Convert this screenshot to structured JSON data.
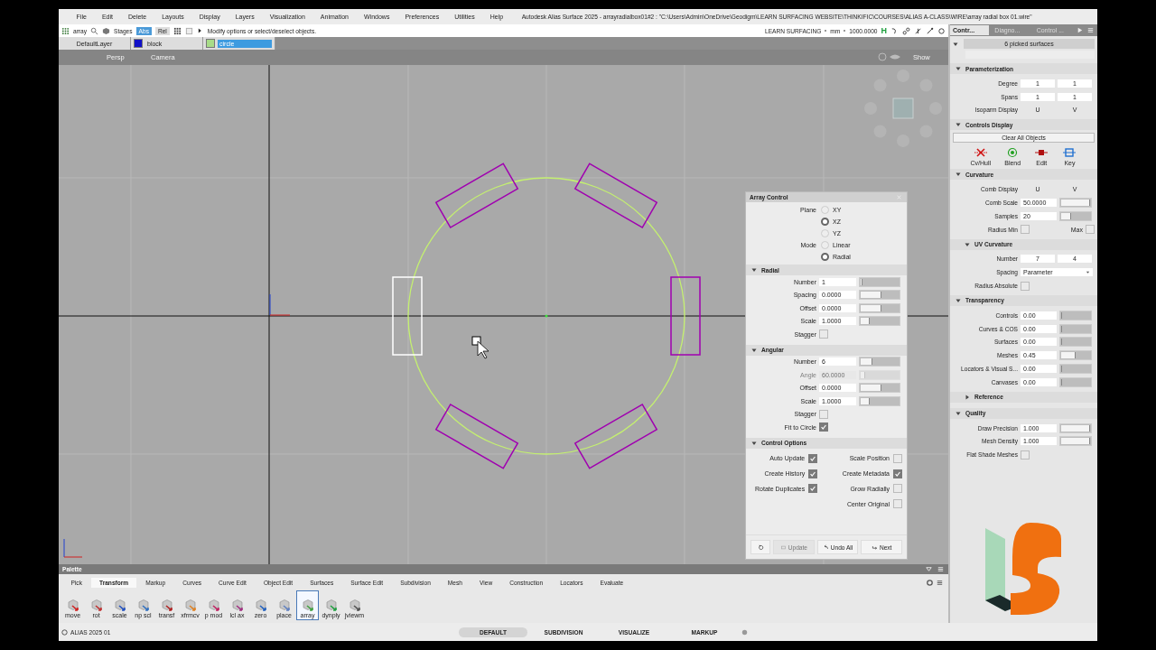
{
  "menu_bar": {
    "items": [
      "File",
      "Edit",
      "Delete",
      "Layouts",
      "Display",
      "Layers",
      "Visualization",
      "Animation",
      "Windows",
      "Preferences",
      "Utilities",
      "Help"
    ],
    "title": "Autodesk Alias Surface 2025   - arrayradialbox01#2 : \"C:\\Users\\Admin\\OneDrive\\Geodigm\\LEARN SURFACING WEBSITE\\THINKIFIC\\COURSES\\ALIAS A-CLASS\\WIRE\\array radial box 01.wire\""
  },
  "toolbar": {
    "tool": "array",
    "stages": "Stages",
    "modes": [
      {
        "label": "Abs",
        "selected": true
      },
      {
        "label": "Rel",
        "selected": false
      }
    ],
    "prompt": "Modify options or select/deselect objects.",
    "project": "LEARN SURFACING",
    "units": "mm",
    "tolerance": "1000.0000",
    "history": "H"
  },
  "layers": [
    {
      "name": "DefaultLayer",
      "selected": false
    },
    {
      "name": "block",
      "color": "#1010c8",
      "selected": false
    },
    {
      "name": "circle",
      "color": "#a8dc88",
      "selected": true
    }
  ],
  "viewport": {
    "view_label": "Persp",
    "camera_label": "Camera",
    "show_label": "Show",
    "boxes": [
      {
        "selected": false
      },
      {
        "selected": false
      },
      {
        "selected": false
      },
      {
        "selected": true
      },
      {
        "selected": false
      },
      {
        "selected": false
      }
    ]
  },
  "array_control": {
    "title": "Array Control",
    "radio_groups": [
      {
        "label": "Plane",
        "options": [
          {
            "label": "XY",
            "selected": false
          },
          {
            "label": "XZ",
            "selected": true
          },
          {
            "label": "YZ",
            "selected": false
          }
        ]
      },
      {
        "label": "Mode",
        "options": [
          {
            "label": "Linear",
            "selected": false
          },
          {
            "label": "Radial",
            "selected": true
          }
        ]
      }
    ],
    "sections": [
      {
        "title": "Radial",
        "expanded": true,
        "rows": [
          {
            "kind": "field",
            "label": "Number",
            "value": "1",
            "level": 0.02,
            "disabled": false
          },
          {
            "kind": "field",
            "label": "Spacing",
            "value": "0.0000",
            "level": 0.5,
            "disabled": false
          },
          {
            "kind": "field",
            "label": "Offset",
            "value": "0.0000",
            "level": 0.5,
            "disabled": false
          },
          {
            "kind": "field",
            "label": "Scale",
            "value": "1.0000",
            "level": 0.2,
            "disabled": false
          },
          {
            "kind": "check",
            "label": "Stagger",
            "checked": false
          }
        ]
      },
      {
        "title": "Angular",
        "expanded": true,
        "rows": [
          {
            "kind": "field",
            "label": "Number",
            "value": "6",
            "level": 0.27,
            "disabled": false
          },
          {
            "kind": "field",
            "label": "Angle",
            "value": "60.0000",
            "level": 0.1,
            "disabled": true
          },
          {
            "kind": "field",
            "label": "Offset",
            "value": "0.0000",
            "level": 0.5,
            "disabled": false
          },
          {
            "kind": "field",
            "label": "Scale",
            "value": "1.0000",
            "level": 0.2,
            "disabled": false
          },
          {
            "kind": "check",
            "label": "Stagger",
            "checked": false
          },
          {
            "kind": "check",
            "label": "Fit to Circle",
            "checked": true
          }
        ]
      }
    ],
    "options": {
      "title": "Control Options",
      "expanded": true,
      "left": [
        {
          "label": "Auto Update",
          "checked": true
        },
        {
          "label": "Create History",
          "checked": true
        },
        {
          "label": "Rotate Duplicates",
          "checked": true
        }
      ],
      "right": [
        {
          "label": "Scale Position",
          "checked": false
        },
        {
          "label": "Create Metadata",
          "checked": true
        },
        {
          "label": "Grow Radially",
          "checked": false
        },
        {
          "label": "Center Original",
          "checked": false
        }
      ]
    },
    "buttons": [
      {
        "kind": "reset"
      },
      {
        "kind": "update",
        "label": "Update",
        "disabled": true
      },
      {
        "kind": "undo",
        "label": "Undo All",
        "disabled": false
      },
      {
        "kind": "next",
        "label": "Next",
        "disabled": false
      }
    ]
  },
  "right_panel": {
    "tabs": [
      {
        "label": "Contr...",
        "selected": true
      },
      {
        "label": "Diagno...",
        "selected": false
      },
      {
        "label": "Control ...",
        "selected": false
      }
    ],
    "header": "6 picked surfaces",
    "sections": [
      {
        "title": "Parameterization",
        "expanded": true,
        "rows": [
          {
            "kind": "pair",
            "label": "Degree",
            "values": [
              "1",
              "1"
            ]
          },
          {
            "kind": "pair",
            "label": "Spans",
            "values": [
              "1",
              "1"
            ]
          },
          {
            "kind": "toggles",
            "label": "Isoparm Display",
            "values": [
              "U",
              "V"
            ]
          }
        ]
      },
      {
        "title": "Controls Display",
        "expanded": true,
        "rows": [
          {
            "kind": "button",
            "label": "Clear All Objects"
          },
          {
            "kind": "icons",
            "items": [
              {
                "kind": "cv",
                "label": "Cv/Hull"
              },
              {
                "kind": "blend",
                "label": "Blend"
              },
              {
                "kind": "edit",
                "label": "Edit"
              },
              {
                "kind": "key",
                "label": "Key"
              }
            ]
          }
        ]
      },
      {
        "title": "Curvature",
        "expanded": true,
        "rows": [
          {
            "kind": "toggles",
            "label": "Comb Display",
            "values": [
              "U",
              "V"
            ]
          },
          {
            "kind": "slider",
            "label": "Comb Scale",
            "value": "50.0000",
            "level": 1
          },
          {
            "kind": "slider",
            "label": "Samples",
            "value": "20",
            "level": 0.3
          },
          {
            "kind": "check_pair",
            "label": "Radius Min",
            "checked": false,
            "label2": "Max",
            "checked2": false
          }
        ],
        "subsections": [
          {
            "title": "UV Curvature",
            "expanded": true,
            "rows": [
              {
                "kind": "pair",
                "label": "Number",
                "values": [
                  "7",
                  "4"
                ]
              },
              {
                "kind": "dropdown",
                "label": "Spacing",
                "value": "Parameter"
              },
              {
                "kind": "check",
                "label": "Radius Absolute",
                "checked": false
              }
            ]
          }
        ]
      },
      {
        "title": "Transparency",
        "expanded": true,
        "rows": [
          {
            "kind": "slider",
            "label": "Controls",
            "value": "0.00",
            "level": 0
          },
          {
            "kind": "slider",
            "label": "Curves & COS",
            "value": "0.00",
            "level": 0
          },
          {
            "kind": "slider",
            "label": "Surfaces",
            "value": "0.00",
            "level": 0
          },
          {
            "kind": "slider",
            "label": "Meshes",
            "value": "0.45",
            "level": 0.45
          },
          {
            "kind": "slider",
            "label": "Locators & Visual S...",
            "value": "0.00",
            "level": 0
          },
          {
            "kind": "slider",
            "label": "Canvases",
            "value": "0.00",
            "level": 0
          }
        ]
      },
      {
        "title": "Reference",
        "expanded": false,
        "indent": true
      },
      {
        "title": "Quality",
        "expanded": true,
        "rows": [
          {
            "kind": "slider",
            "label": "Draw Precision",
            "value": "1.000",
            "level": 1
          },
          {
            "kind": "slider",
            "label": "Mesh Density",
            "value": "1.000",
            "level": 1
          },
          {
            "kind": "check",
            "label": "Flat Shade Meshes",
            "checked": false
          }
        ]
      }
    ]
  },
  "palette": {
    "title": "Palette",
    "tabs": [
      {
        "label": "Pick",
        "selected": false
      },
      {
        "label": "Transform",
        "selected": true
      },
      {
        "label": "Markup",
        "selected": false
      },
      {
        "label": "Curves",
        "selected": false
      },
      {
        "label": "Curve Edit",
        "selected": false
      },
      {
        "label": "Object Edit",
        "selected": false
      },
      {
        "label": "Surfaces",
        "selected": false
      },
      {
        "label": "Surface Edit",
        "selected": false
      },
      {
        "label": "Subdivision",
        "selected": false
      },
      {
        "label": "Mesh",
        "selected": false
      },
      {
        "label": "View",
        "selected": false
      },
      {
        "label": "Construction",
        "selected": false
      },
      {
        "label": "Locators",
        "selected": false
      },
      {
        "label": "Evaluate",
        "selected": false
      }
    ],
    "tools": [
      {
        "label": "move",
        "selected": false
      },
      {
        "label": "rot",
        "selected": false
      },
      {
        "label": "scale",
        "selected": false
      },
      {
        "label": "np scl",
        "selected": false
      },
      {
        "label": "transf",
        "selected": false
      },
      {
        "label": "xfrmcv",
        "selected": false
      },
      {
        "label": "p mod",
        "selected": false
      },
      {
        "label": "lcl ax",
        "selected": false
      },
      {
        "label": "zero",
        "selected": false
      },
      {
        "label": "place",
        "selected": false
      },
      {
        "label": "array",
        "selected": true
      },
      {
        "label": "dynply",
        "selected": false
      },
      {
        "label": "jviewm",
        "selected": false
      }
    ]
  },
  "status_bar": {
    "version": "ALIAS 2025 01",
    "modes": [
      {
        "label": "DEFAULT",
        "selected": true
      },
      {
        "label": "SUBDIVISION",
        "selected": false
      },
      {
        "label": "VISUALIZE",
        "selected": false
      },
      {
        "label": "MARKUP",
        "selected": false
      }
    ]
  }
}
